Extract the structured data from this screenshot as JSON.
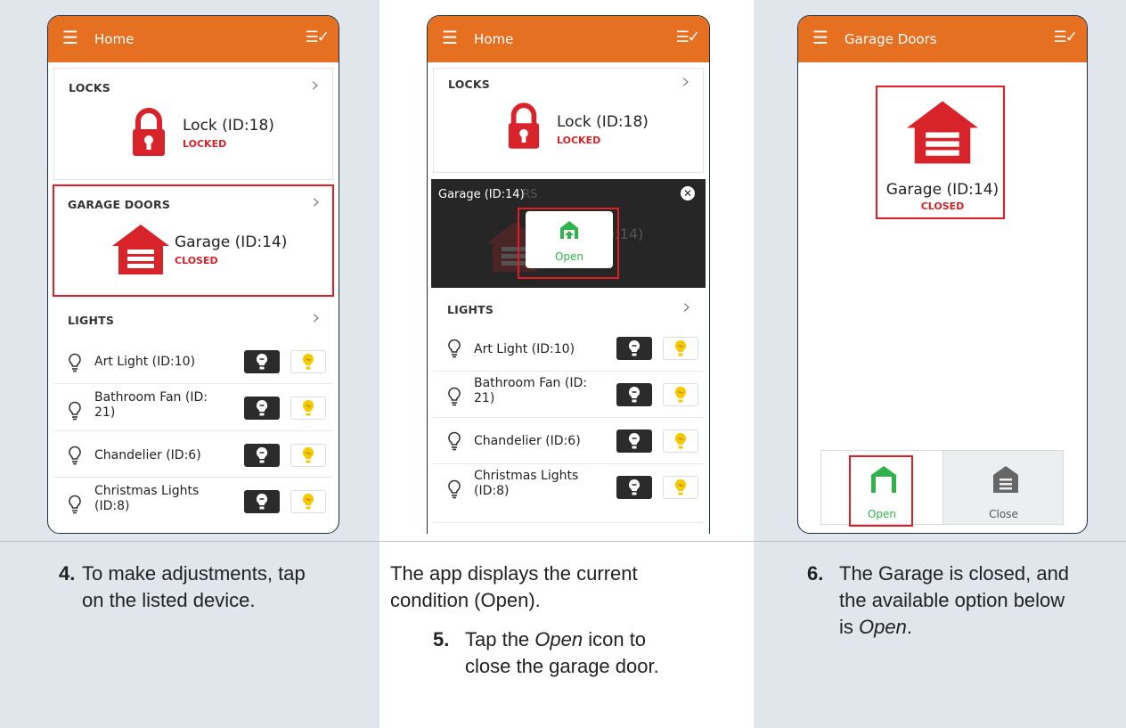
{
  "panels": [
    {
      "header_title": "Home",
      "locks": {
        "title": "LOCKS",
        "device": "Lock (ID:18)",
        "state": "LOCKED"
      },
      "garage": {
        "title": "GARAGE DOORS",
        "device": "Garage (ID:14)",
        "state": "CLOSED"
      },
      "lights": {
        "title": "LIGHTS",
        "items": [
          {
            "line1": "Art Light (ID:10)",
            "line2": ""
          },
          {
            "line1": "Bathroom Fan (ID:",
            "line2": "21)"
          },
          {
            "line1": "Chandelier (ID:6)",
            "line2": ""
          },
          {
            "line1": "Christmas Lights",
            "line2": "(ID:8)"
          }
        ]
      }
    },
    {
      "header_title": "Home",
      "locks": {
        "title": "LOCKS",
        "device": "Lock (ID:18)",
        "state": "LOCKED"
      },
      "overlay": {
        "title": "Garage (ID:14)",
        "behind_fragment_1": "RS",
        "behind_fragment_2": "):14)",
        "popup_label": "Open"
      },
      "lights": {
        "title": "LIGHTS",
        "items": [
          {
            "line1": "Art Light (ID:10)",
            "line2": ""
          },
          {
            "line1": "Bathroom Fan (ID:",
            "line2": "21)"
          },
          {
            "line1": "Chandelier (ID:6)",
            "line2": ""
          },
          {
            "line1": "Christmas Lights",
            "line2": "(ID:8)"
          }
        ]
      }
    },
    {
      "header_title": "Garage Doors",
      "device": "Garage (ID:14)",
      "state": "CLOSED",
      "buttons": {
        "open": "Open",
        "close": "Close"
      }
    }
  ],
  "captions": {
    "step4_num": "4.",
    "step4_text_1": "To make adjustments, tap",
    "step4_text_2": "on the listed device.",
    "mid_text_1": "The app displays the current",
    "mid_text_2": "condition (Open).",
    "step5_num": "5.",
    "step5_text_1a": "Tap the ",
    "step5_text_1b": "Open",
    "step5_text_1c": " icon to",
    "step5_text_2": "close the garage door.",
    "step6_num": "6.",
    "step6_text_1": "The Garage is closed, and",
    "step6_text_2": "the available option below",
    "step6_text_3a": "is ",
    "step6_text_3b": "Open",
    "step6_text_3c": "."
  },
  "colors": {
    "header": "#e67022",
    "lock_red": "#d8232a",
    "highlight": "#e21d25",
    "open_green": "#2fb34a",
    "bulb_yellow": "#f6c800"
  }
}
